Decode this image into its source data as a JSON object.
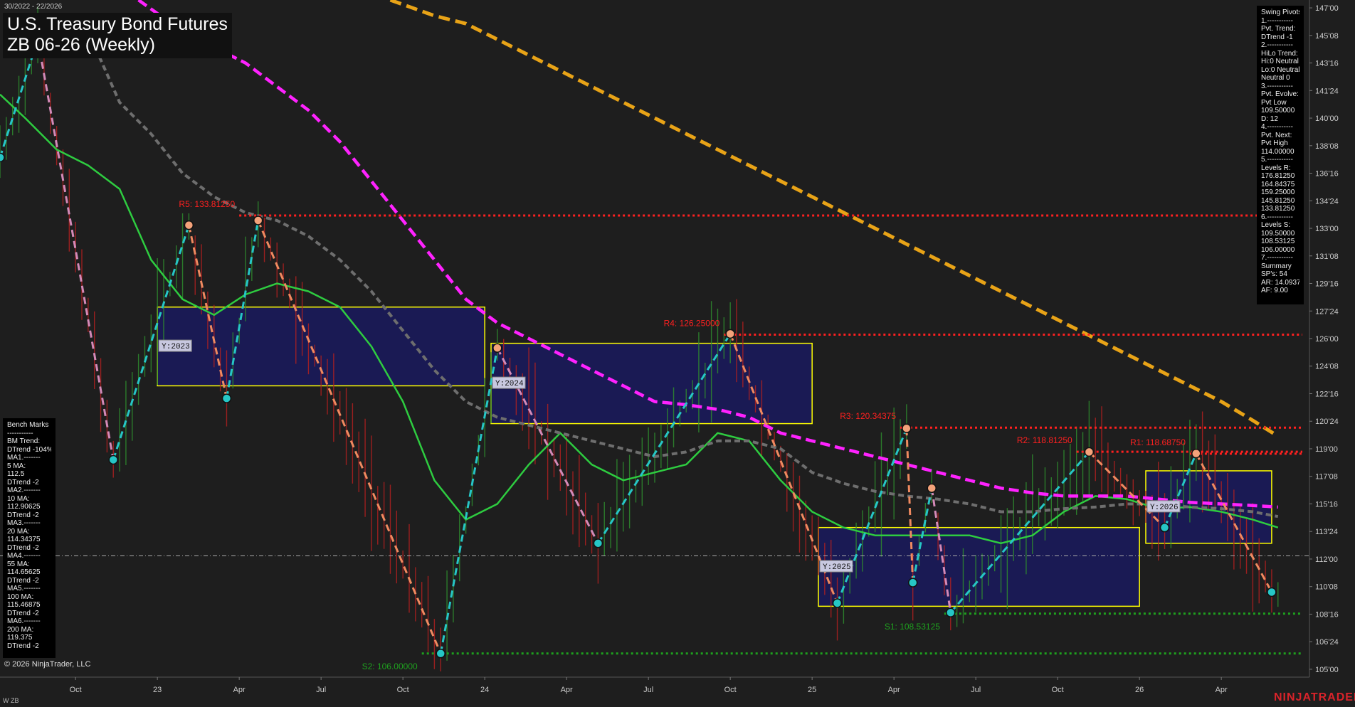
{
  "header": {
    "date_range": "30/2022 - 22/2026",
    "title": "U.S. Treasury Bond Futures",
    "subtitle": "ZB 06-26 (Weekly)"
  },
  "swing_pivots_panel": [
    "Swing Pivots",
    "1.-----------",
    "Pvt. Trend:",
    "DTrend -1",
    "2.-----------",
    "HiLo Trend:",
    "Hi:0 Neutral",
    "Lo:0 Neutral",
    "Neutral 0",
    "3.-----------",
    "Pvt. Evolve:",
    "Pvt Low",
    "109.50000",
    "D: 12",
    "4.-----------",
    "Pvt. Next:",
    "Pvt High",
    "114.00000",
    "5.-----------",
    "Levels R:",
    "176.81250",
    "164.84375",
    "159.25000",
    "145.81250",
    "133.81250",
    "6.-----------",
    "Levels S:",
    "109.50000",
    "108.53125",
    "106.00000",
    "7.-----------",
    "Summary",
    "SP's: 54",
    "AR: 14.09375",
    "AF: 9.00"
  ],
  "bench_marks_panel": [
    "Bench Marks",
    "-----------",
    "BM Trend:",
    "DTrend -104%",
    "MA1.-------",
    "5 MA:",
    "112.5",
    "DTrend -2",
    "MA2.-------",
    "10 MA:",
    "112.90625",
    "DTrend -2",
    "MA3.-------",
    "20 MA:",
    "114.34375",
    "DTrend -2",
    "MA4.-------",
    "55 MA:",
    "114.65625",
    "DTrend -2",
    "MA5.-------",
    "100 MA:",
    "115.46875",
    "DTrend -2",
    "MA6.-------",
    "200 MA:",
    "119.375",
    "DTrend -2"
  ],
  "footer": {
    "copyright": "© 2026 NinjaTrader, LLC",
    "corner_label": "W ZB",
    "logo": "NINJATRADER"
  },
  "colors": {
    "background": "#1e1e1e",
    "resistance": "#ff2020",
    "support": "#1ea01e",
    "zone_fill": "#1a1a5e",
    "zone_border": "#ffff00",
    "ma_green": "#2ecc40",
    "ma_gray": "#6e6e6e",
    "ma_magenta": "#ff22ff",
    "ma_orange": "#e8a317",
    "swing_up": "#26c6c6",
    "swing_down": "#f08a60",
    "swing_down_soft": "#d48ab8",
    "bar_up": "#2e8b2e",
    "bar_down": "#b02020"
  },
  "chart_data": {
    "type": "line",
    "title": "U.S. Treasury Bond Futures ZB 06-26 (Weekly)",
    "y_range": [
      104.5,
      147.5
    ],
    "y_ticks": [
      {
        "label": "147'00",
        "value": 147.0
      },
      {
        "label": "145'08",
        "value": 145.25
      },
      {
        "label": "143'16",
        "value": 143.5
      },
      {
        "label": "141'24",
        "value": 141.75
      },
      {
        "label": "140'00",
        "value": 140.0
      },
      {
        "label": "138'08",
        "value": 138.25
      },
      {
        "label": "136'16",
        "value": 136.5
      },
      {
        "label": "134'24",
        "value": 134.75
      },
      {
        "label": "133'00",
        "value": 133.0
      },
      {
        "label": "131'08",
        "value": 131.25
      },
      {
        "label": "129'16",
        "value": 129.5
      },
      {
        "label": "127'24",
        "value": 127.75
      },
      {
        "label": "126'00",
        "value": 126.0
      },
      {
        "label": "124'08",
        "value": 124.25
      },
      {
        "label": "122'16",
        "value": 122.5
      },
      {
        "label": "120'24",
        "value": 120.75
      },
      {
        "label": "119'00",
        "value": 119.0
      },
      {
        "label": "117'08",
        "value": 117.25
      },
      {
        "label": "115'16",
        "value": 115.5
      },
      {
        "label": "113'24",
        "value": 113.75
      },
      {
        "label": "112'00",
        "value": 112.0
      },
      {
        "label": "110'08",
        "value": 110.25
      },
      {
        "label": "108'16",
        "value": 108.5
      },
      {
        "label": "106'24",
        "value": 106.75
      },
      {
        "label": "105'00",
        "value": 105.0
      }
    ],
    "x_ticks": [
      {
        "label": "Oct",
        "week": 8
      },
      {
        "label": "23",
        "week": 21
      },
      {
        "label": "Apr",
        "week": 34
      },
      {
        "label": "Jul",
        "week": 47
      },
      {
        "label": "Oct",
        "week": 60
      },
      {
        "label": "24",
        "week": 73
      },
      {
        "label": "Apr",
        "week": 86
      },
      {
        "label": "Jul",
        "week": 99
      },
      {
        "label": "Oct",
        "week": 112
      },
      {
        "label": "25",
        "week": 125
      },
      {
        "label": "Apr",
        "week": 138
      },
      {
        "label": "Jul",
        "week": 151
      },
      {
        "label": "Oct",
        "week": 164
      },
      {
        "label": "26",
        "week": 177
      },
      {
        "label": "Apr",
        "week": 190
      }
    ],
    "week_range": [
      -4,
      204
    ],
    "current_price": 112.2,
    "resistance_levels": [
      {
        "label": "R5: 133.81250",
        "value": 133.8125,
        "from_week": 34
      },
      {
        "label": "R4: 126.25000",
        "value": 126.25,
        "from_week": 111
      },
      {
        "label": "R3: 120.34375",
        "value": 120.34375,
        "from_week": 139
      },
      {
        "label": "R2: 118.81250",
        "value": 118.8125,
        "from_week": 167
      },
      {
        "label": "R1: 118.68750",
        "value": 118.6875,
        "from_week": 185
      }
    ],
    "support_levels": [
      {
        "label": "S2: 106.00000",
        "value": 106.0,
        "from_week": 63
      },
      {
        "label": "S1: 108.53125",
        "value": 108.53125,
        "from_week": 146
      }
    ],
    "yearly_zones": [
      {
        "label": "Y:2023",
        "start_week": 21,
        "end_week": 73,
        "high": 128.0,
        "low": 123.0
      },
      {
        "label": "Y:2024",
        "start_week": 74,
        "end_week": 125,
        "high": 125.7,
        "low": 120.6
      },
      {
        "label": "Y:2025",
        "start_week": 126,
        "end_week": 177,
        "high": 114.0,
        "low": 109.0
      },
      {
        "label": "Y:2026",
        "start_week": 178,
        "end_week": 198,
        "high": 117.6,
        "low": 113.0
      }
    ],
    "swing_pivots": [
      {
        "week": -4,
        "value": 137.5,
        "kind": "low"
      },
      {
        "week": 2,
        "value": 145.0,
        "kind": "high"
      },
      {
        "week": 14,
        "value": 118.3,
        "kind": "low"
      },
      {
        "week": 26,
        "value": 133.2,
        "kind": "high"
      },
      {
        "week": 32,
        "value": 122.2,
        "kind": "low"
      },
      {
        "week": 37,
        "value": 133.5,
        "kind": "high"
      },
      {
        "week": 66,
        "value": 106.0,
        "kind": "low"
      },
      {
        "week": 75,
        "value": 125.4,
        "kind": "high"
      },
      {
        "week": 91,
        "value": 113.0,
        "kind": "low"
      },
      {
        "week": 112,
        "value": 126.3,
        "kind": "high"
      },
      {
        "week": 129,
        "value": 109.2,
        "kind": "low"
      },
      {
        "week": 140,
        "value": 120.3,
        "kind": "high"
      },
      {
        "week": 141,
        "value": 110.5,
        "kind": "low"
      },
      {
        "week": 144,
        "value": 116.5,
        "kind": "high"
      },
      {
        "week": 147,
        "value": 108.6,
        "kind": "low"
      },
      {
        "week": 169,
        "value": 118.8,
        "kind": "high"
      },
      {
        "week": 181,
        "value": 114.0,
        "kind": "low"
      },
      {
        "week": 186,
        "value": 118.7,
        "kind": "high"
      },
      {
        "week": 198,
        "value": 109.9,
        "kind": "low"
      }
    ],
    "series": [
      {
        "name": "5 MA",
        "style": "green",
        "weeks": [
          -4,
          0,
          5,
          10,
          15,
          20,
          25,
          30,
          35,
          40,
          45,
          50,
          55,
          60,
          65,
          70,
          75,
          80,
          85,
          90,
          95,
          100,
          105,
          110,
          115,
          120,
          125,
          130,
          135,
          140,
          145,
          150,
          155,
          160,
          165,
          170,
          175,
          180,
          185,
          190,
          195,
          199
        ],
        "values": [
          141.5,
          140.0,
          138.0,
          137.0,
          135.5,
          131.0,
          128.5,
          127.5,
          128.8,
          129.5,
          129.0,
          128.0,
          125.5,
          122.0,
          117.0,
          114.5,
          115.5,
          118.0,
          120.0,
          118.0,
          117.0,
          117.5,
          118.0,
          120.0,
          119.5,
          117.0,
          115.0,
          114.0,
          113.5,
          113.5,
          113.5,
          113.5,
          113.0,
          113.5,
          115.0,
          116.0,
          115.8,
          115.2,
          115.3,
          115.0,
          114.5,
          114.0
        ]
      },
      {
        "name": "55 MA",
        "style": "gray",
        "weeks": [
          10,
          15,
          20,
          25,
          30,
          35,
          40,
          45,
          50,
          55,
          60,
          65,
          70,
          75,
          80,
          85,
          90,
          95,
          100,
          105,
          110,
          115,
          120,
          125,
          130,
          135,
          140,
          145,
          150,
          155,
          160,
          165,
          170,
          175,
          180,
          185,
          190,
          195,
          199
        ],
        "values": [
          145.5,
          141.0,
          139.0,
          136.5,
          135.0,
          134.0,
          133.5,
          132.5,
          131.0,
          129.0,
          126.5,
          124.0,
          122.0,
          121.0,
          120.5,
          120.0,
          119.5,
          119.0,
          118.5,
          118.8,
          119.5,
          119.5,
          119.0,
          117.5,
          116.8,
          116.3,
          116.0,
          115.8,
          115.5,
          115.0,
          115.0,
          115.2,
          115.3,
          115.5,
          115.5,
          115.3,
          115.2,
          115.0,
          114.7
        ]
      },
      {
        "name": "100 MA",
        "style": "magenta",
        "weeks": [
          18,
          25,
          30,
          35,
          40,
          45,
          50,
          55,
          60,
          65,
          70,
          75,
          80,
          85,
          90,
          95,
          100,
          105,
          110,
          115,
          120,
          125,
          130,
          135,
          140,
          145,
          150,
          155,
          160,
          165,
          170,
          175,
          180,
          185,
          190,
          195,
          199
        ],
        "values": [
          147.5,
          145.5,
          144.5,
          143.5,
          142.0,
          140.5,
          138.5,
          136.0,
          133.5,
          131.0,
          128.5,
          127.0,
          126.0,
          125.0,
          124.0,
          123.0,
          122.0,
          121.8,
          121.5,
          121.0,
          120.0,
          119.5,
          119.0,
          118.5,
          118.0,
          117.5,
          117.0,
          116.5,
          116.2,
          116.0,
          116.0,
          116.0,
          115.8,
          115.6,
          115.5,
          115.4,
          115.3
        ]
      },
      {
        "name": "200 MA",
        "style": "orange",
        "weeks": [
          58,
          65,
          70,
          75,
          80,
          85,
          90,
          95,
          100,
          105,
          110,
          115,
          120,
          125,
          130,
          135,
          140,
          145,
          150,
          155,
          160,
          165,
          170,
          175,
          180,
          185,
          190,
          195,
          199
        ],
        "values": [
          147.5,
          146.5,
          146.0,
          145.0,
          144.0,
          143.0,
          142.0,
          141.0,
          140.0,
          139.0,
          138.0,
          137.0,
          136.0,
          135.0,
          134.0,
          133.0,
          132.0,
          131.0,
          130.0,
          129.0,
          128.0,
          127.0,
          126.0,
          125.0,
          124.0,
          123.0,
          122.0,
          120.8,
          119.8
        ]
      }
    ]
  }
}
